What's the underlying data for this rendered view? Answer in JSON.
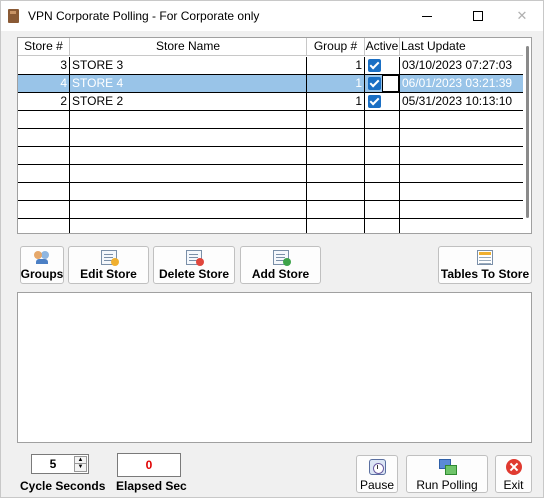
{
  "window": {
    "title": "VPN Corporate Polling - For Corporate only",
    "minimize_glyph": "",
    "close_glyph": "✕"
  },
  "grid": {
    "columns": [
      "Store #",
      "Store Name",
      "Group #",
      "Active",
      "Last Update"
    ],
    "rows": [
      {
        "store_num": "3",
        "store_name": "STORE 3",
        "group_num": "1",
        "active": true,
        "last_update": "03/10/2023 07:27:03",
        "selected": false
      },
      {
        "store_num": "4",
        "store_name": "STORE 4",
        "group_num": "1",
        "active": true,
        "last_update": "06/01/2023 03:21:39",
        "selected": true
      },
      {
        "store_num": "2",
        "store_name": "STORE 2",
        "group_num": "1",
        "active": true,
        "last_update": "05/31/2023 10:13:10",
        "selected": false
      }
    ],
    "empty_rows": 7
  },
  "toolbar": {
    "groups_label": "Groups",
    "edit_store_label": "Edit Store",
    "delete_store_label": "Delete Store",
    "add_store_label": "Add Store",
    "tables_to_store_label": "Tables To Store"
  },
  "bottom": {
    "cycle_seconds_value": "5",
    "cycle_seconds_label": "Cycle Seconds",
    "elapsed_value": "0",
    "elapsed_label": "Elapsed Sec",
    "pause_label": "Pause",
    "run_polling_label": "Run Polling",
    "exit_label": "Exit"
  },
  "colors": {
    "selected_row": "#99c4e8",
    "checkbox": "#1a6fc4",
    "elapsed_text": "#e00000"
  }
}
